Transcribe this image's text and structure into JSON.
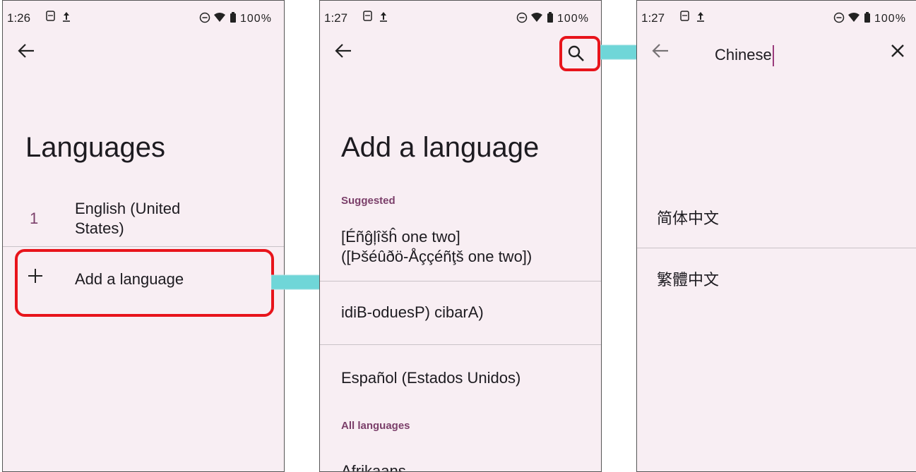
{
  "screens": [
    {
      "status": {
        "time": "1:26",
        "icons": "⊖ ⭳",
        "right": "⊖ ▼ ▮ 100%"
      },
      "title": "Languages",
      "languages": [
        {
          "number": "1",
          "name_line1": "English (United",
          "name_line2": "States)"
        }
      ],
      "add_label": "Add a language",
      "add_icon": "plus-icon"
    },
    {
      "status": {
        "time": "1:27",
        "icons": "⊖ ⭳",
        "right": "⊖ ▼ ▮ 100%"
      },
      "title": "Add a language",
      "suggested_label": "Suggested",
      "suggested": [
        {
          "line1": "[Éñĝļîšĥ one two]",
          "line2": "([Þšéûðö-Åççéñţš one two])"
        },
        {
          "line1": "idiB-oduesP) cibarA)"
        },
        {
          "line1": "Español (Estados Unidos)"
        }
      ],
      "all_label": "All languages",
      "all_first": "Afrikaans"
    },
    {
      "status": {
        "time": "1:27",
        "icons": "⊖ ⭳",
        "right": "⊖ ▼ ▮ 100%"
      },
      "search_value": "Chinese",
      "results": [
        "简体中文",
        "繁體中文"
      ]
    }
  ],
  "colors": {
    "screen_bg": "#f8eef3",
    "accent": "#7b3f6a",
    "highlight": "#e8141b",
    "arrow": "#6fd6d8"
  }
}
